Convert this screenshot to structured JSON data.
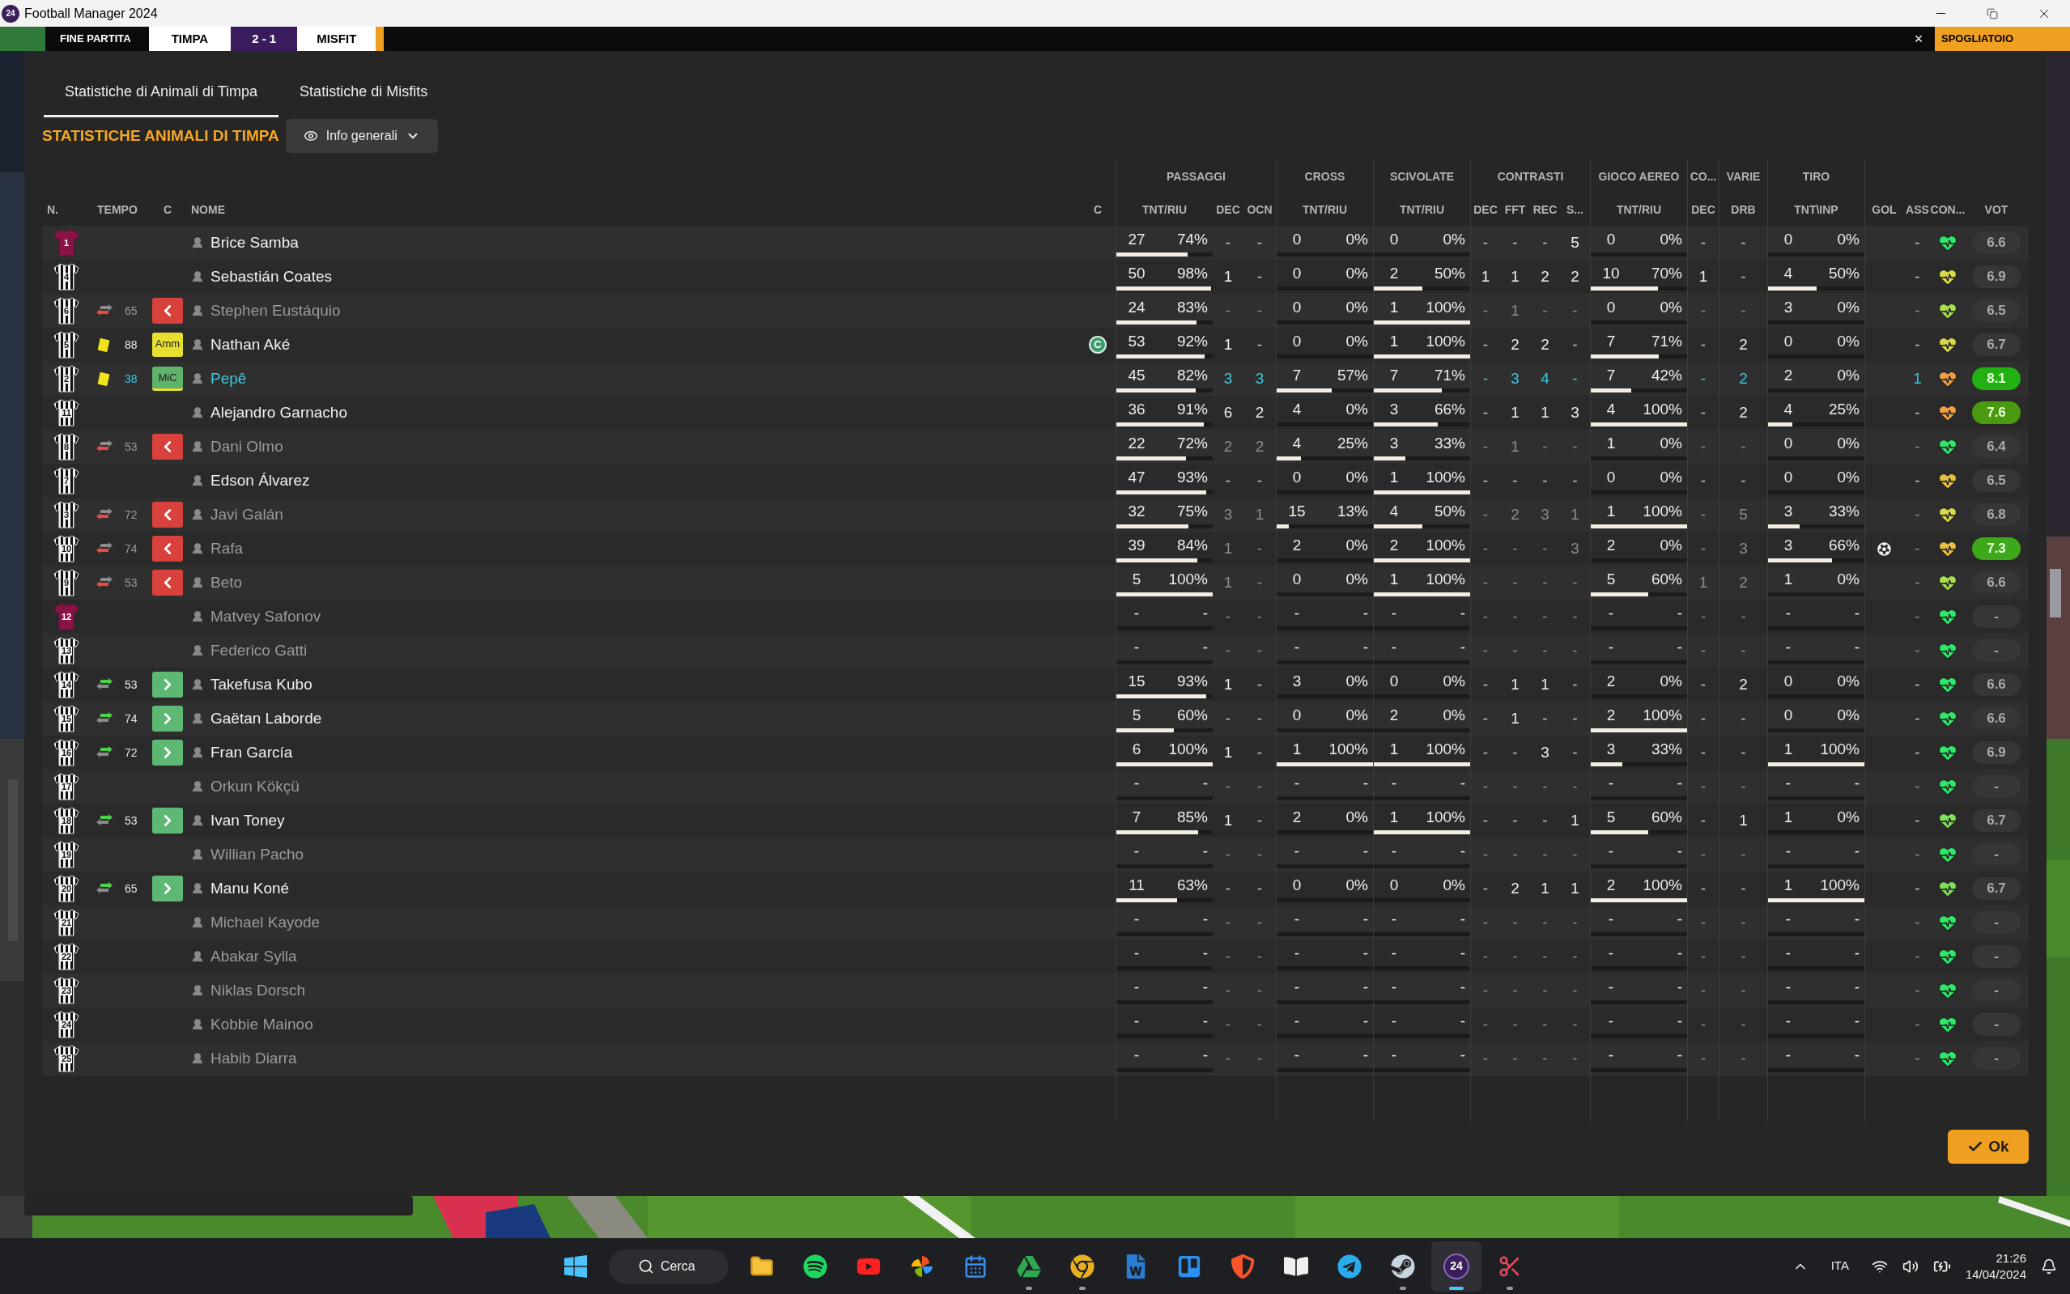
{
  "window": {
    "title": "Football Manager 2024",
    "logo_text": "24"
  },
  "match_bar": {
    "status": "FINE PARTITA",
    "home": "TIMPA",
    "score": "2 - 1",
    "away": "MISFIT",
    "close": "×",
    "action": "SPOGLIATOIO"
  },
  "tabs": [
    {
      "label": "Statistiche di Animali di Timpa",
      "selected": true
    },
    {
      "label": "Statistiche di Misfits",
      "selected": false
    }
  ],
  "section_title": "STATISTICHE ANIMALI DI TIMPA",
  "view_dropdown": {
    "label": "Info generali"
  },
  "table": {
    "groups": [
      "PASSAGGI",
      "CROSS",
      "SCIVOLATE",
      "CONTRASTI",
      "GIOCO AEREO",
      "CO...",
      "VARIE",
      "TIRO"
    ],
    "columns": [
      "N.",
      "TEMPO",
      "C",
      "NOME",
      "C",
      "TNT/RIU",
      "DEC",
      "OCN",
      "TNT/RIU",
      "TNT/RIU",
      "DEC",
      "FFT",
      "REC",
      "S...",
      "TNT/RIU",
      "DEC",
      "DRB",
      "TNT\\INP",
      "GOL",
      "ASS",
      "CON...",
      "VOT"
    ],
    "rows": [
      {
        "num": "1",
        "keeper": true,
        "subbed_off": false,
        "subbed_on": false,
        "booked": false,
        "name": "Brice Samba",
        "dimmed": false,
        "selected": false,
        "pairs": [
          [
            "27",
            "74%"
          ],
          [
            "0",
            "0%"
          ],
          [
            "0",
            "0%"
          ],
          [
            "0",
            "0%"
          ],
          [
            "0",
            "0%"
          ]
        ],
        "singles": [
          "-",
          "-",
          "-",
          "-",
          "-",
          "5",
          "-",
          "-",
          "-"
        ],
        "goal": false,
        "color": "#2ee86a",
        "vote": {
          "text": "6.6"
        }
      },
      {
        "num": "4",
        "keeper": false,
        "subbed_off": false,
        "subbed_on": false,
        "booked": false,
        "name": "Sebastián Coates",
        "dimmed": false,
        "selected": false,
        "pairs": [
          [
            "50",
            "98%"
          ],
          [
            "0",
            "0%"
          ],
          [
            "2",
            "50%"
          ],
          [
            "10",
            "70%"
          ],
          [
            "4",
            "50%"
          ]
        ],
        "singles": [
          "1",
          "-",
          "1",
          "1",
          "2",
          "2",
          "1",
          "-",
          "-"
        ],
        "goal": false,
        "color": "#d8d84a",
        "vote": {
          "text": "6.9"
        }
      },
      {
        "num": "6",
        "keeper": false,
        "subbed_off": true,
        "subbed_on": false,
        "booked": false,
        "time": "65",
        "name": "Stephen Eustáquio",
        "dimmed": true,
        "selected": false,
        "pairs": [
          [
            "24",
            "83%"
          ],
          [
            "0",
            "0%"
          ],
          [
            "1",
            "100%"
          ],
          [
            "0",
            "0%"
          ],
          [
            "3",
            "0%"
          ]
        ],
        "singles": [
          "-",
          "-",
          "-",
          "1",
          "-",
          "-",
          "-",
          "-",
          "-"
        ],
        "goal": false,
        "color": "#a6e04a",
        "vote": {
          "text": "6.5"
        }
      },
      {
        "num": "5",
        "keeper": false,
        "subbed_off": false,
        "subbed_on": false,
        "booked": true,
        "time": "88",
        "tag": {
          "text": "Amm",
          "color": "#e8e030"
        },
        "name": "Nathan Aké",
        "dimmed": false,
        "selected": false,
        "captain_mark": "C",
        "pairs": [
          [
            "53",
            "92%"
          ],
          [
            "0",
            "0%"
          ],
          [
            "1",
            "100%"
          ],
          [
            "7",
            "71%"
          ],
          [
            "0",
            "0%"
          ]
        ],
        "singles": [
          "1",
          "-",
          "-",
          "2",
          "2",
          "-",
          "-",
          "2",
          "-"
        ],
        "goal": false,
        "color": "#d8d84a",
        "vote": {
          "text": "6.7"
        }
      },
      {
        "num": "2",
        "keeper": false,
        "subbed_off": false,
        "subbed_on": false,
        "booked": true,
        "time": "38",
        "tag": {
          "text": "MiC",
          "color": "#5fb36a"
        },
        "name": "Pepê",
        "dimmed": false,
        "selected": true,
        "pairs": [
          [
            "45",
            "82%"
          ],
          [
            "7",
            "57%"
          ],
          [
            "7",
            "71%"
          ],
          [
            "7",
            "42%"
          ],
          [
            "2",
            "0%"
          ]
        ],
        "singles": [
          "3",
          "3",
          "-",
          "3",
          "4",
          "-",
          "-",
          "2",
          "1"
        ],
        "goal": false,
        "color": "#f0a040",
        "vote": {
          "text": "8.1",
          "color": "#22b012"
        }
      },
      {
        "num": "11",
        "keeper": false,
        "subbed_off": false,
        "subbed_on": false,
        "booked": false,
        "name": "Alejandro Garnacho",
        "dimmed": false,
        "selected": false,
        "pairs": [
          [
            "36",
            "91%"
          ],
          [
            "4",
            "0%"
          ],
          [
            "3",
            "66%"
          ],
          [
            "4",
            "100%"
          ],
          [
            "4",
            "25%"
          ]
        ],
        "singles": [
          "6",
          "2",
          "-",
          "1",
          "1",
          "3",
          "-",
          "2",
          "-"
        ],
        "goal": false,
        "color": "#f0a040",
        "vote": {
          "text": "7.6",
          "color": "#4a9a10"
        }
      },
      {
        "num": "8",
        "keeper": false,
        "subbed_off": true,
        "subbed_on": false,
        "booked": false,
        "time": "53",
        "name": "Dani Olmo",
        "dimmed": true,
        "selected": false,
        "pairs": [
          [
            "22",
            "72%"
          ],
          [
            "4",
            "25%"
          ],
          [
            "3",
            "33%"
          ],
          [
            "1",
            "0%"
          ],
          [
            "0",
            "0%"
          ]
        ],
        "singles": [
          "2",
          "2",
          "-",
          "1",
          "-",
          "-",
          "-",
          "-",
          "-"
        ],
        "goal": false,
        "color": "#2ee86a",
        "vote": {
          "text": "6.4"
        }
      },
      {
        "num": "7",
        "keeper": false,
        "subbed_off": false,
        "subbed_on": false,
        "booked": false,
        "name": "Edson Álvarez",
        "dimmed": false,
        "selected": false,
        "pairs": [
          [
            "47",
            "93%"
          ],
          [
            "0",
            "0%"
          ],
          [
            "1",
            "100%"
          ],
          [
            "0",
            "0%"
          ],
          [
            "0",
            "0%"
          ]
        ],
        "singles": [
          "-",
          "-",
          "-",
          "-",
          "-",
          "-",
          "-",
          "-",
          "-"
        ],
        "goal": false,
        "color": "#e8c040",
        "vote": {
          "text": "6.5"
        }
      },
      {
        "num": "3",
        "keeper": false,
        "subbed_off": true,
        "subbed_on": false,
        "booked": false,
        "time": "72",
        "name": "Javi Galán",
        "dimmed": true,
        "selected": false,
        "pairs": [
          [
            "32",
            "75%"
          ],
          [
            "15",
            "13%"
          ],
          [
            "4",
            "50%"
          ],
          [
            "1",
            "100%"
          ],
          [
            "3",
            "33%"
          ]
        ],
        "singles": [
          "3",
          "1",
          "-",
          "2",
          "3",
          "1",
          "-",
          "5",
          "-"
        ],
        "goal": false,
        "color": "#d8d84a",
        "vote": {
          "text": "6.8"
        }
      },
      {
        "num": "10",
        "keeper": false,
        "subbed_off": true,
        "subbed_on": false,
        "booked": false,
        "time": "74",
        "name": "Rafa",
        "dimmed": true,
        "selected": false,
        "pairs": [
          [
            "39",
            "84%"
          ],
          [
            "2",
            "0%"
          ],
          [
            "2",
            "100%"
          ],
          [
            "2",
            "0%"
          ],
          [
            "3",
            "66%"
          ]
        ],
        "singles": [
          "1",
          "-",
          "-",
          "-",
          "-",
          "3",
          "-",
          "3",
          "-"
        ],
        "goal": true,
        "color": "#e8c040",
        "vote": {
          "text": "7.3",
          "color": "#3ea81a"
        }
      },
      {
        "num": "9",
        "keeper": false,
        "subbed_off": true,
        "subbed_on": false,
        "booked": false,
        "time": "53",
        "name": "Beto",
        "dimmed": true,
        "selected": false,
        "pairs": [
          [
            "5",
            "100%"
          ],
          [
            "0",
            "0%"
          ],
          [
            "1",
            "100%"
          ],
          [
            "5",
            "60%"
          ],
          [
            "1",
            "0%"
          ]
        ],
        "singles": [
          "1",
          "-",
          "-",
          "-",
          "-",
          "-",
          "1",
          "2",
          "-"
        ],
        "goal": false,
        "color": "#a6e04a",
        "vote": {
          "text": "6.6"
        }
      },
      {
        "num": "12",
        "keeper": true,
        "subbed_off": false,
        "subbed_on": false,
        "booked": false,
        "name": "Matvey Safonov",
        "dimmed": true,
        "selected": false,
        "pairs": [
          [
            "-",
            "-"
          ],
          [
            "-",
            "-"
          ],
          [
            "-",
            "-"
          ],
          [
            "-",
            "-"
          ],
          [
            "-",
            "-"
          ]
        ],
        "singles": [
          "-",
          "-",
          "-",
          "-",
          "-",
          "-",
          "-",
          "-",
          "-"
        ],
        "goal": false,
        "color": "#2ee86a",
        "vote": {
          "text": "-"
        }
      },
      {
        "num": "13",
        "keeper": false,
        "subbed_off": false,
        "subbed_on": false,
        "booked": false,
        "name": "Federico Gatti",
        "dimmed": true,
        "selected": false,
        "pairs": [
          [
            "-",
            "-"
          ],
          [
            "-",
            "-"
          ],
          [
            "-",
            "-"
          ],
          [
            "-",
            "-"
          ],
          [
            "-",
            "-"
          ]
        ],
        "singles": [
          "-",
          "-",
          "-",
          "-",
          "-",
          "-",
          "-",
          "-",
          "-"
        ],
        "goal": false,
        "color": "#2ee86a",
        "vote": {
          "text": "-"
        }
      },
      {
        "num": "14",
        "keeper": false,
        "subbed_off": false,
        "subbed_on": true,
        "booked": false,
        "time": "53",
        "name": "Takefusa Kubo",
        "dimmed": false,
        "selected": false,
        "pairs": [
          [
            "15",
            "93%"
          ],
          [
            "3",
            "0%"
          ],
          [
            "0",
            "0%"
          ],
          [
            "2",
            "0%"
          ],
          [
            "0",
            "0%"
          ]
        ],
        "singles": [
          "1",
          "-",
          "-",
          "1",
          "1",
          "-",
          "-",
          "2",
          "-"
        ],
        "goal": false,
        "color": "#2ee86a",
        "vote": {
          "text": "6.6"
        }
      },
      {
        "num": "15",
        "keeper": false,
        "subbed_off": false,
        "subbed_on": true,
        "booked": false,
        "time": "74",
        "name": "Gaëtan Laborde",
        "dimmed": false,
        "selected": false,
        "pairs": [
          [
            "5",
            "60%"
          ],
          [
            "0",
            "0%"
          ],
          [
            "2",
            "0%"
          ],
          [
            "2",
            "100%"
          ],
          [
            "0",
            "0%"
          ]
        ],
        "singles": [
          "-",
          "-",
          "-",
          "1",
          "-",
          "-",
          "-",
          "-",
          "-"
        ],
        "goal": false,
        "color": "#2ee86a",
        "vote": {
          "text": "6.6"
        }
      },
      {
        "num": "16",
        "keeper": false,
        "subbed_off": false,
        "subbed_on": true,
        "booked": false,
        "time": "72",
        "name": "Fran García",
        "dimmed": false,
        "selected": false,
        "pairs": [
          [
            "6",
            "100%"
          ],
          [
            "1",
            "100%"
          ],
          [
            "1",
            "100%"
          ],
          [
            "3",
            "33%"
          ],
          [
            "1",
            "100%"
          ]
        ],
        "singles": [
          "1",
          "-",
          "-",
          "-",
          "3",
          "-",
          "-",
          "-",
          "-"
        ],
        "goal": false,
        "color": "#2ee86a",
        "vote": {
          "text": "6.9"
        }
      },
      {
        "num": "17",
        "keeper": false,
        "subbed_off": false,
        "subbed_on": false,
        "booked": false,
        "name": "Orkun Kökçü",
        "dimmed": true,
        "selected": false,
        "pairs": [
          [
            "-",
            "-"
          ],
          [
            "-",
            "-"
          ],
          [
            "-",
            "-"
          ],
          [
            "-",
            "-"
          ],
          [
            "-",
            "-"
          ]
        ],
        "singles": [
          "-",
          "-",
          "-",
          "-",
          "-",
          "-",
          "-",
          "-",
          "-"
        ],
        "goal": false,
        "color": "#2ee86a",
        "vote": {
          "text": "-"
        }
      },
      {
        "num": "18",
        "keeper": false,
        "subbed_off": false,
        "subbed_on": true,
        "booked": false,
        "time": "53",
        "name": "Ivan Toney",
        "dimmed": false,
        "selected": false,
        "pairs": [
          [
            "7",
            "85%"
          ],
          [
            "2",
            "0%"
          ],
          [
            "1",
            "100%"
          ],
          [
            "5",
            "60%"
          ],
          [
            "1",
            "0%"
          ]
        ],
        "singles": [
          "1",
          "-",
          "-",
          "-",
          "-",
          "1",
          "-",
          "1",
          "-"
        ],
        "goal": false,
        "color": "#7fe05a",
        "vote": {
          "text": "6.7"
        }
      },
      {
        "num": "19",
        "keeper": false,
        "subbed_off": false,
        "subbed_on": false,
        "booked": false,
        "name": "Willian Pacho",
        "dimmed": true,
        "selected": false,
        "pairs": [
          [
            "-",
            "-"
          ],
          [
            "-",
            "-"
          ],
          [
            "-",
            "-"
          ],
          [
            "-",
            "-"
          ],
          [
            "-",
            "-"
          ]
        ],
        "singles": [
          "-",
          "-",
          "-",
          "-",
          "-",
          "-",
          "-",
          "-",
          "-"
        ],
        "goal": false,
        "color": "#2ee86a",
        "vote": {
          "text": "-"
        }
      },
      {
        "num": "20",
        "keeper": false,
        "subbed_off": false,
        "subbed_on": true,
        "booked": false,
        "time": "65",
        "name": "Manu Koné",
        "dimmed": false,
        "selected": false,
        "pairs": [
          [
            "11",
            "63%"
          ],
          [
            "0",
            "0%"
          ],
          [
            "0",
            "0%"
          ],
          [
            "2",
            "100%"
          ],
          [
            "1",
            "100%"
          ]
        ],
        "singles": [
          "-",
          "-",
          "-",
          "2",
          "1",
          "1",
          "-",
          "-",
          "-"
        ],
        "goal": false,
        "color": "#7fe05a",
        "vote": {
          "text": "6.7"
        }
      },
      {
        "num": "21",
        "keeper": false,
        "subbed_off": false,
        "subbed_on": false,
        "booked": false,
        "name": "Michael Kayode",
        "dimmed": true,
        "selected": false,
        "pairs": [
          [
            "-",
            "-"
          ],
          [
            "-",
            "-"
          ],
          [
            "-",
            "-"
          ],
          [
            "-",
            "-"
          ],
          [
            "-",
            "-"
          ]
        ],
        "singles": [
          "-",
          "-",
          "-",
          "-",
          "-",
          "-",
          "-",
          "-",
          "-"
        ],
        "goal": false,
        "color": "#2ee86a",
        "vote": {
          "text": "-"
        }
      },
      {
        "num": "22",
        "keeper": false,
        "subbed_off": false,
        "subbed_on": false,
        "booked": false,
        "name": "Abakar Sylla",
        "dimmed": true,
        "selected": false,
        "pairs": [
          [
            "-",
            "-"
          ],
          [
            "-",
            "-"
          ],
          [
            "-",
            "-"
          ],
          [
            "-",
            "-"
          ],
          [
            "-",
            "-"
          ]
        ],
        "singles": [
          "-",
          "-",
          "-",
          "-",
          "-",
          "-",
          "-",
          "-",
          "-"
        ],
        "goal": false,
        "color": "#2ee86a",
        "vote": {
          "text": "-"
        }
      },
      {
        "num": "23",
        "keeper": false,
        "subbed_off": false,
        "subbed_on": false,
        "booked": false,
        "name": "Niklas Dorsch",
        "dimmed": true,
        "selected": false,
        "pairs": [
          [
            "-",
            "-"
          ],
          [
            "-",
            "-"
          ],
          [
            "-",
            "-"
          ],
          [
            "-",
            "-"
          ],
          [
            "-",
            "-"
          ]
        ],
        "singles": [
          "-",
          "-",
          "-",
          "-",
          "-",
          "-",
          "-",
          "-",
          "-"
        ],
        "goal": false,
        "color": "#2ee86a",
        "vote": {
          "text": "-"
        }
      },
      {
        "num": "24",
        "keeper": false,
        "subbed_off": false,
        "subbed_on": false,
        "booked": false,
        "name": "Kobbie Mainoo",
        "dimmed": true,
        "selected": false,
        "pairs": [
          [
            "-",
            "-"
          ],
          [
            "-",
            "-"
          ],
          [
            "-",
            "-"
          ],
          [
            "-",
            "-"
          ],
          [
            "-",
            "-"
          ]
        ],
        "singles": [
          "-",
          "-",
          "-",
          "-",
          "-",
          "-",
          "-",
          "-",
          "-"
        ],
        "goal": false,
        "color": "#2ee86a",
        "vote": {
          "text": "-"
        }
      },
      {
        "num": "25",
        "keeper": false,
        "subbed_off": false,
        "subbed_on": false,
        "booked": false,
        "name": "Habib Diarra",
        "dimmed": true,
        "selected": false,
        "pairs": [
          [
            "-",
            "-"
          ],
          [
            "-",
            "-"
          ],
          [
            "-",
            "-"
          ],
          [
            "-",
            "-"
          ],
          [
            "-",
            "-"
          ]
        ],
        "singles": [
          "-",
          "-",
          "-",
          "-",
          "-",
          "-",
          "-",
          "-",
          "-"
        ],
        "goal": false,
        "color": "#2ee86a",
        "vote": {
          "text": "-"
        }
      }
    ]
  },
  "ok_button": "Ok",
  "taskbar": {
    "search": "Cerca",
    "apps": [
      {
        "kind": "folder",
        "running": false
      },
      {
        "kind": "music",
        "running": false
      },
      {
        "kind": "video",
        "running": false
      },
      {
        "kind": "photos",
        "running": false
      },
      {
        "kind": "calendar",
        "running": false
      },
      {
        "kind": "drive",
        "running": true
      },
      {
        "kind": "browser",
        "running": true
      },
      {
        "kind": "word",
        "running": false
      },
      {
        "kind": "board",
        "running": false
      },
      {
        "kind": "shield",
        "running": false
      },
      {
        "kind": "notes",
        "running": false
      },
      {
        "kind": "messenger",
        "running": false
      },
      {
        "kind": "steam",
        "running": true
      },
      {
        "kind": "game",
        "label": "24",
        "running": true
      },
      {
        "kind": "snip",
        "running": true
      }
    ],
    "lang": "ITA",
    "time": "21:26",
    "date": "14/04/2024"
  }
}
